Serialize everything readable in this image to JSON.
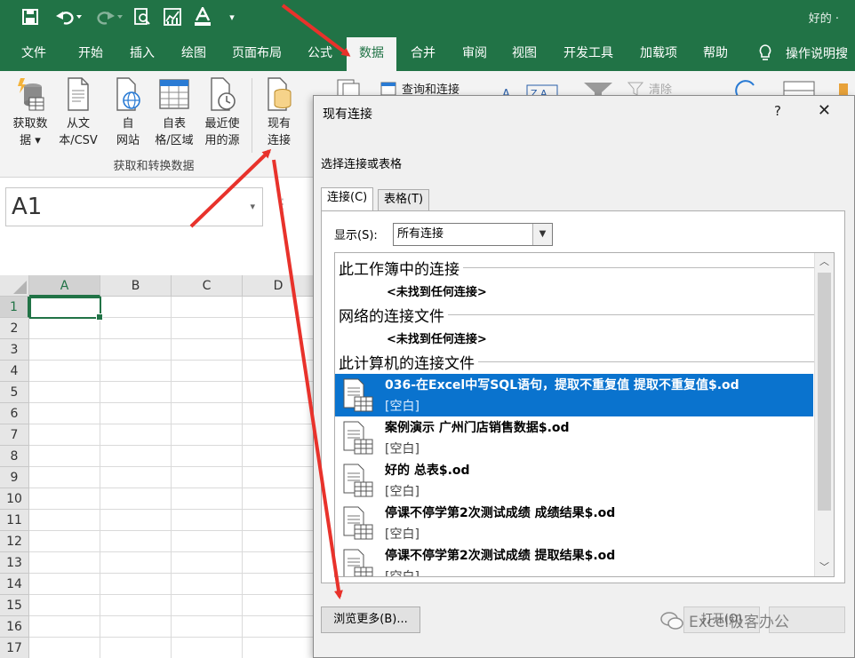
{
  "title_bar": {
    "user_name": "好的 ·",
    "qat": {
      "save": "save-icon",
      "undo": "undo-icon",
      "redo": "redo-icon",
      "print_preview": "print-preview-icon",
      "chart": "chart-icon",
      "font_color": "font-color-icon",
      "customize": "customize-qat-icon"
    }
  },
  "menu": {
    "tabs": [
      "文件",
      "开始",
      "插入",
      "绘图",
      "页面布局",
      "公式",
      "数据",
      "合并",
      "审阅",
      "视图",
      "开发工具",
      "加载项",
      "帮助"
    ],
    "active_tab": "数据",
    "tell_me": "操作说明搜"
  },
  "ribbon": {
    "group_get_transform": {
      "label": "获取和转换数据",
      "buttons": [
        {
          "label": "获取数\n据 ▾",
          "icon": "database-icon"
        },
        {
          "label": "从文\n本/CSV",
          "icon": "text-file-icon"
        },
        {
          "label": "自\n网站",
          "icon": "web-icon"
        },
        {
          "label": "自表\n格/区域",
          "icon": "table-icon"
        },
        {
          "label": "最近使\n用的源",
          "icon": "recent-sources-icon"
        },
        {
          "label": "现有\n连接",
          "icon": "existing-connections-icon"
        }
      ]
    },
    "query_connections": "查询和连接",
    "clear": "清除"
  },
  "formula_bar": {
    "name_box": "A1"
  },
  "grid": {
    "columns": [
      "A",
      "B",
      "C",
      "D"
    ],
    "rows": [
      "1",
      "2",
      "3",
      "4",
      "5",
      "6",
      "7",
      "8",
      "9",
      "10",
      "11",
      "12",
      "13",
      "14",
      "15",
      "16",
      "17"
    ],
    "selected_cell": "A1"
  },
  "dialog": {
    "title": "现有连接",
    "help": "?",
    "close": "✕",
    "subtitle": "选择连接或表格",
    "tabs": [
      "连接(C)",
      "表格(T)"
    ],
    "show_label": "显示(S):",
    "show_value": "所有连接",
    "sections": [
      {
        "heading": "此工作簿中的连接",
        "empty_note": "<未找到任何连接>"
      },
      {
        "heading": "网络的连接文件",
        "empty_note": "<未找到任何连接>"
      },
      {
        "heading": "此计算机的连接文件"
      }
    ],
    "connections": [
      {
        "name": "036-在Excel中写SQL语句，提取不重复值 提取不重复值$.od",
        "desc": "[空白]",
        "selected": true
      },
      {
        "name": "案例演示 广州门店销售数据$.od",
        "desc": "[空白]",
        "selected": false
      },
      {
        "name": "好的 总表$.od",
        "desc": "[空白]",
        "selected": false
      },
      {
        "name": "停课不停学第2次测试成绩 成绩结果$.od",
        "desc": "[空白]",
        "selected": false
      },
      {
        "name": "停课不停学第2次测试成绩 提取结果$.od",
        "desc": "[空白]",
        "selected": false
      }
    ],
    "browse_button": "浏览更多(B)...",
    "open_button": "打开(O)",
    "watermark": "Excel极客办公"
  },
  "colors": {
    "excel_green": "#217346",
    "selection_blue": "#0a73ce",
    "annotation_red": "#e8322b"
  }
}
